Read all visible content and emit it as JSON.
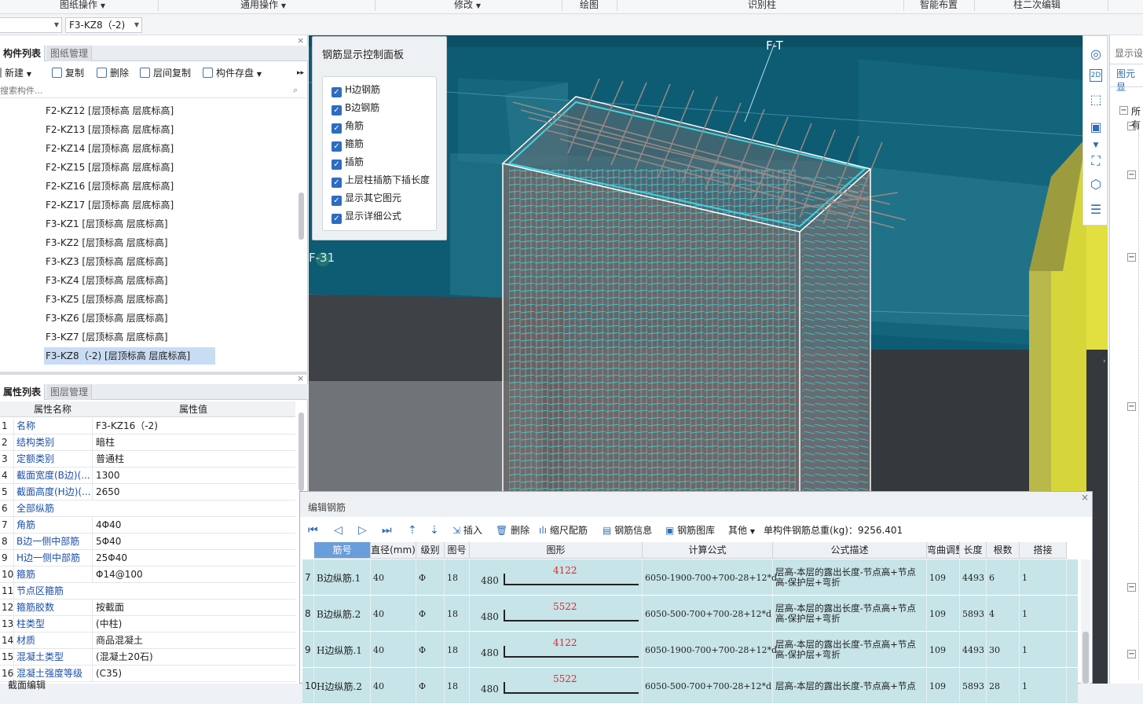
{
  "ribbon": {
    "groups": [
      "图纸操作",
      "通用操作",
      "修改",
      "绘图",
      "识别柱",
      "智能布置",
      "柱二次编辑"
    ]
  },
  "toolbar2": {
    "combo1_value": "",
    "combo2_value": "F3-KZ8（-2)"
  },
  "component_panel": {
    "tabs": [
      "构件列表",
      "图纸管理"
    ],
    "actions": [
      "新建",
      "复制",
      "删除",
      "层间复制",
      "构件存盘"
    ],
    "search_placeholder": "搜索构件...",
    "items": [
      "F2-KZ12 [层顶标高 层底标高]",
      "F2-KZ13 [层顶标高 层底标高]",
      "F2-KZ14 [层顶标高 层底标高]",
      "F2-KZ15 [层顶标高 层底标高]",
      "F2-KZ16 [层顶标高 层底标高]",
      "F2-KZ17 [层顶标高 层底标高]",
      "F3-KZ1 [层顶标高 层底标高]",
      "F3-KZ2 [层顶标高 层底标高]",
      "F3-KZ3 [层顶标高 层底标高]",
      "F3-KZ4 [层顶标高 层底标高]",
      "F3-KZ5 [层顶标高 层底标高]",
      "F3-KZ6 [层顶标高 层底标高]",
      "F3-KZ7 [层顶标高 层底标高]",
      "F3-KZ8（-2) [层顶标高 层底标高]"
    ],
    "selected_index": 13
  },
  "property_panel": {
    "tabs": [
      "属性列表",
      "图层管理"
    ],
    "col_name": "属性名称",
    "col_value": "属性值",
    "rows": [
      {
        "n": "1",
        "k": "名称",
        "v": "F3-KZ16（-2)"
      },
      {
        "n": "2",
        "k": "结构类别",
        "v": "暗柱"
      },
      {
        "n": "3",
        "k": "定额类别",
        "v": "普通柱"
      },
      {
        "n": "4",
        "k": "截面宽度(B边)(...",
        "v": "1300"
      },
      {
        "n": "5",
        "k": "截面高度(H边)(...",
        "v": "2650"
      },
      {
        "n": "6",
        "k": "全部纵筋",
        "v": ""
      },
      {
        "n": "7",
        "k": "角筋",
        "v": "4Φ40"
      },
      {
        "n": "8",
        "k": "B边一侧中部筋",
        "v": "5Φ40"
      },
      {
        "n": "9",
        "k": "H边一侧中部筋",
        "v": "25Φ40"
      },
      {
        "n": "10",
        "k": "箍筋",
        "v": "Φ14@100"
      },
      {
        "n": "11",
        "k": "节点区箍筋",
        "v": ""
      },
      {
        "n": "12",
        "k": "箍筋胶数",
        "v": "按截面"
      },
      {
        "n": "13",
        "k": "柱类型",
        "v": "(中柱)"
      },
      {
        "n": "14",
        "k": "材质",
        "v": "商品混凝土"
      },
      {
        "n": "15",
        "k": "混凝土类型",
        "v": "(混凝土20石)"
      },
      {
        "n": "16",
        "k": "混凝土强度等级",
        "v": "(C35)"
      }
    ]
  },
  "viewport": {
    "axis_top": "F-T",
    "axis_left": "F-31"
  },
  "control_panel": {
    "title": "钢筋显示控制面板",
    "options": [
      {
        "label": "H边钢筋",
        "checked": true
      },
      {
        "label": "B边钢筋",
        "checked": true
      },
      {
        "label": "角筋",
        "checked": true
      },
      {
        "label": "箍筋",
        "checked": true
      },
      {
        "label": "插筋",
        "checked": true
      },
      {
        "label": "上层柱插筋下插长度",
        "checked": true
      },
      {
        "label": "显示其它图元",
        "checked": true
      },
      {
        "label": "显示详细公式",
        "checked": true
      }
    ]
  },
  "right_panel": {
    "tab": "显示设",
    "sub": "图元显",
    "tree_label": "所有"
  },
  "rebar_dialog": {
    "title": "编辑钢筋",
    "actions": [
      "插入",
      "删除",
      "缩尺配筋",
      "钢筋信息",
      "钢筋图库",
      "其他"
    ],
    "total_label": "单构件钢筋总重(kg)：9256.401",
    "columns": [
      "筋号",
      "直径(mm)",
      "级别",
      "图号",
      "图形",
      "计算公式",
      "公式描述",
      "弯曲调整",
      "长度",
      "根数",
      "搭接"
    ],
    "rows": [
      {
        "idx": "7",
        "name": "B边纵筋.1",
        "dia": "40",
        "grade": "Φ",
        "fig": "18",
        "shape_left": "480",
        "shape_len": "4122",
        "formula": "6050-1900-700+700-28+12*d",
        "desc": "层高-本层的露出长度-节点高+节点高-保护层+弯折",
        "bend": "109",
        "length": "4493",
        "count": "6",
        "lap": "1"
      },
      {
        "idx": "8",
        "name": "B边纵筋.2",
        "dia": "40",
        "grade": "Φ",
        "fig": "18",
        "shape_left": "480",
        "shape_len": "5522",
        "formula": "6050-500-700+700-28+12*d",
        "desc": "层高-本层的露出长度-节点高+节点高-保护层+弯折",
        "bend": "109",
        "length": "5893",
        "count": "4",
        "lap": "1"
      },
      {
        "idx": "9",
        "name": "H边纵筋.1",
        "dia": "40",
        "grade": "Φ",
        "fig": "18",
        "shape_left": "480",
        "shape_len": "4122",
        "formula": "6050-1900-700+700-28+12*d",
        "desc": "层高-本层的露出长度-节点高+节点高-保护层+弯折",
        "bend": "109",
        "length": "4493",
        "count": "30",
        "lap": "1"
      },
      {
        "idx": "10",
        "name": "H边纵筋.2",
        "dia": "40",
        "grade": "Φ",
        "fig": "18",
        "shape_left": "480",
        "shape_len": "5522",
        "formula": "6050-500-700+700-28+12*d",
        "desc": "层高-本层的露出长度-节点高+节点",
        "bend": "109",
        "length": "5893",
        "count": "28",
        "lap": "1"
      }
    ]
  },
  "bottom_left": {
    "label": "截面编辑"
  },
  "colors": {
    "accent": "#2f6db5",
    "rebar_row": "#c7e4e8",
    "selected": "#c8dcf4",
    "cyan": "#3fd6e0",
    "shape_text": "#e0262a"
  }
}
